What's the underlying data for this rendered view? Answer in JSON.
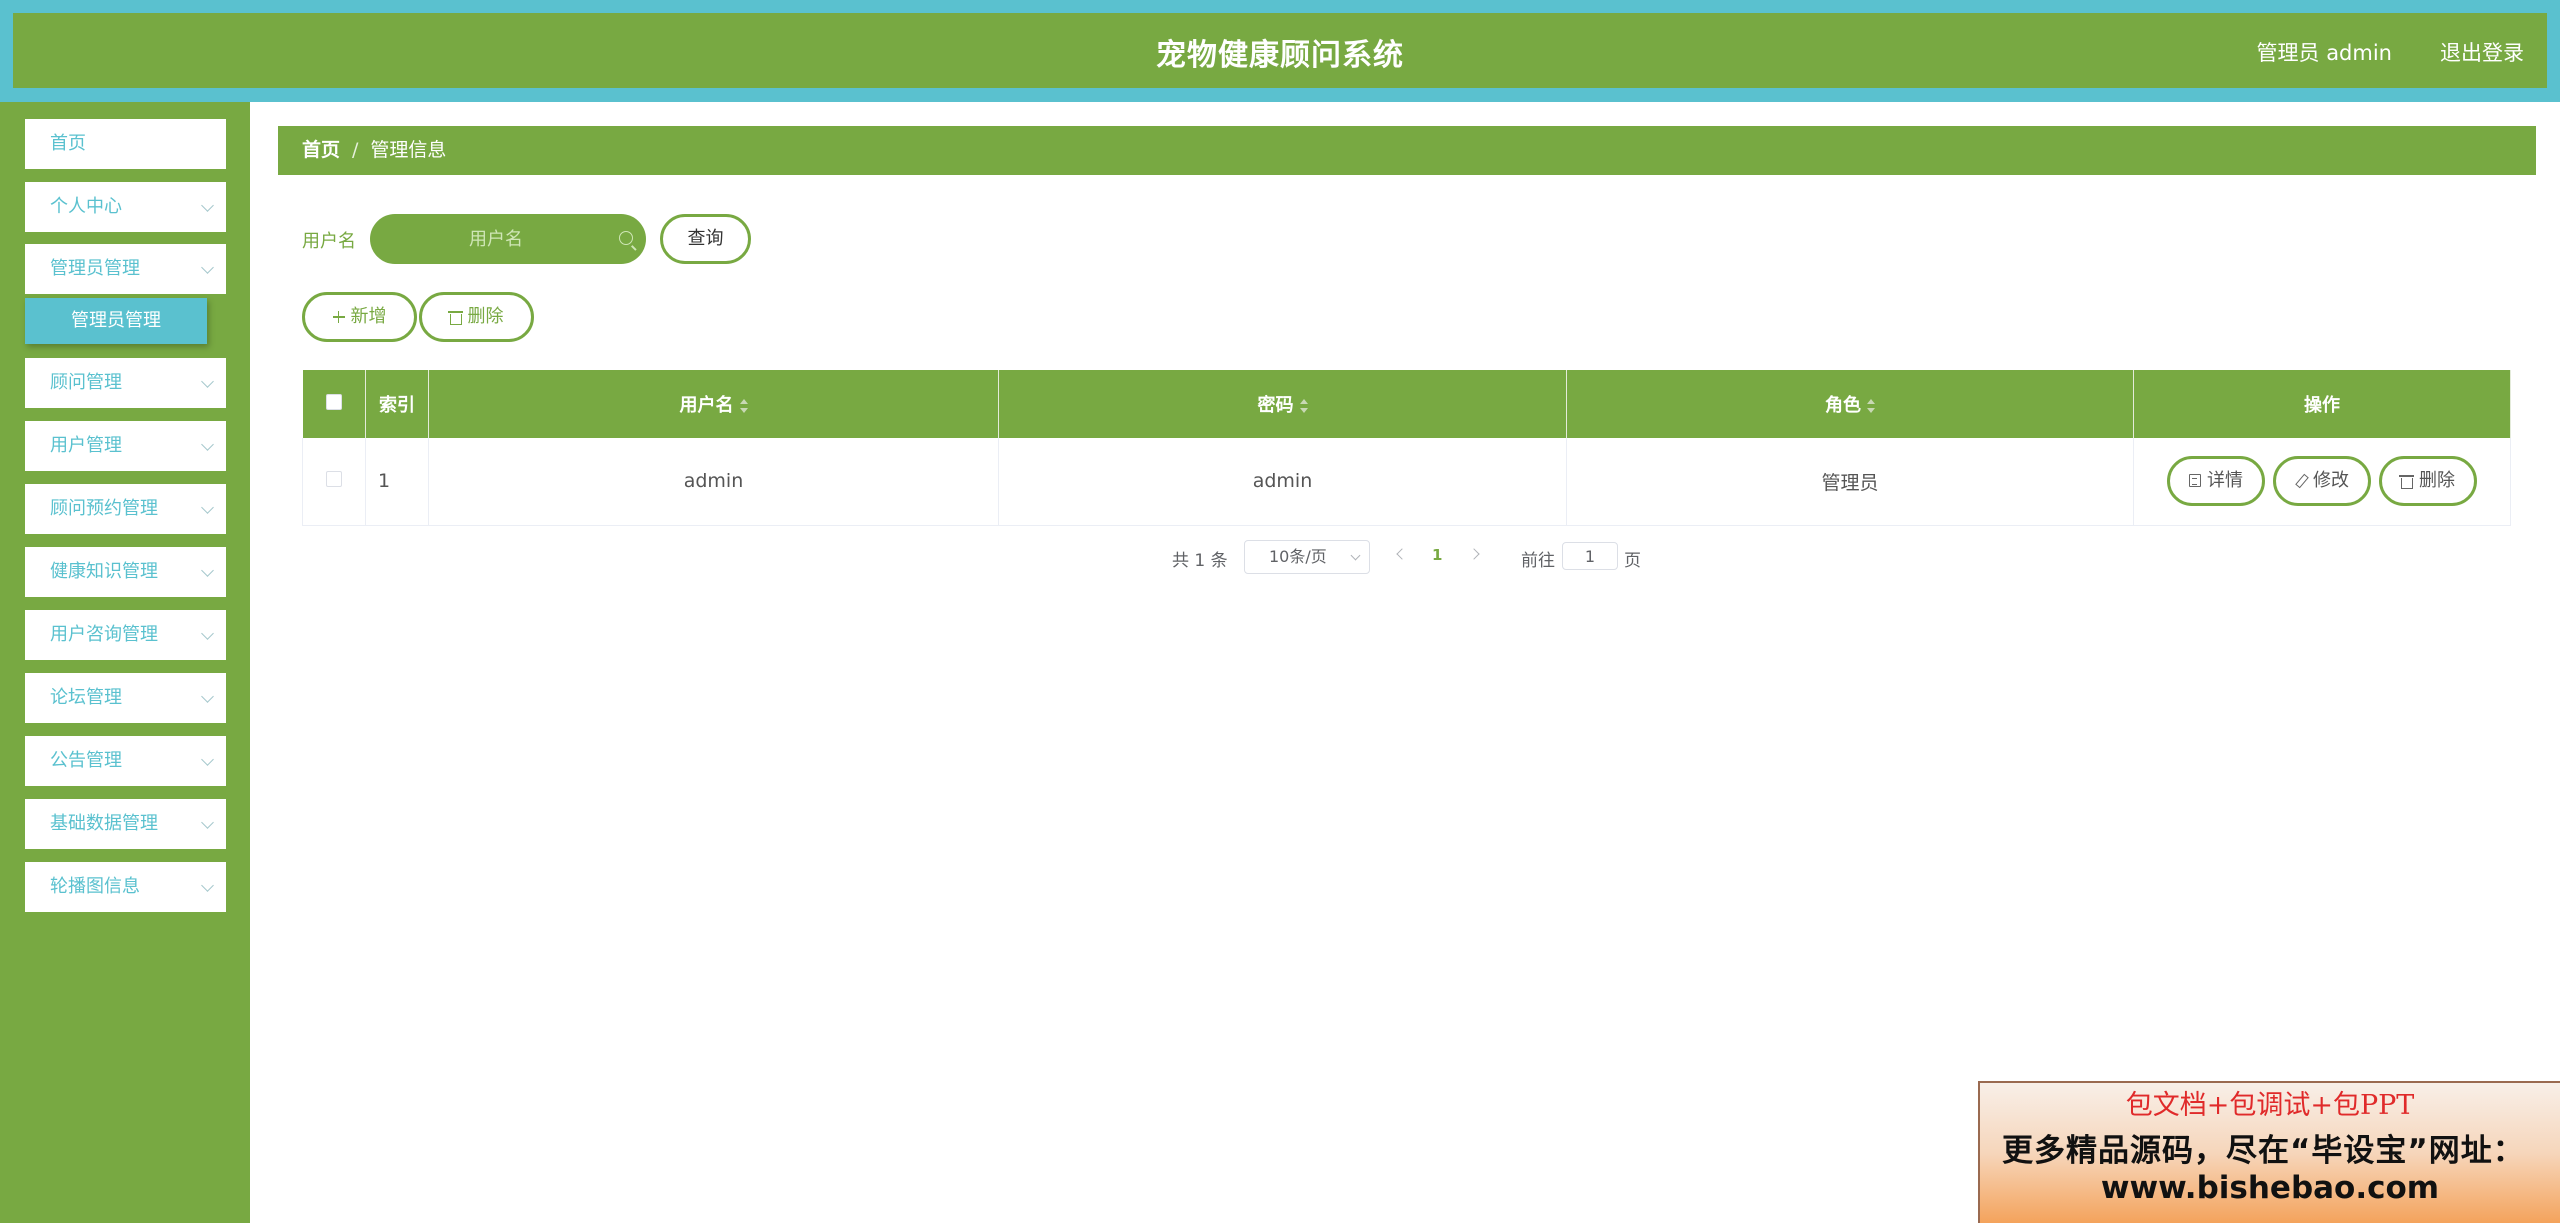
{
  "header": {
    "title": "宠物健康顾问系统",
    "user_info": "管理员 admin",
    "logout": "退出登录"
  },
  "sidebar": {
    "items": [
      {
        "label": "首页"
      },
      {
        "label": "个人中心"
      },
      {
        "label": "管理员管理"
      },
      {
        "label": "顾问管理"
      },
      {
        "label": "用户管理"
      },
      {
        "label": "顾问预约管理"
      },
      {
        "label": "健康知识管理"
      },
      {
        "label": "用户咨询管理"
      },
      {
        "label": "论坛管理"
      },
      {
        "label": "公告管理"
      },
      {
        "label": "基础数据管理"
      },
      {
        "label": "轮播图信息"
      }
    ],
    "active_submenu": "管理员管理"
  },
  "breadcrumb": {
    "home": "首页",
    "separator": "/",
    "current": "管理信息"
  },
  "search": {
    "label": "用户名",
    "placeholder": "用户名",
    "query_button": "查询"
  },
  "actions": {
    "add": "新增",
    "delete": "删除"
  },
  "table": {
    "columns": {
      "index": "索引",
      "username": "用户名",
      "password": "密码",
      "role": "角色",
      "operations": "操作"
    },
    "rows": [
      {
        "index": "1",
        "username": "admin",
        "password": "admin",
        "role": "管理员"
      }
    ],
    "row_actions": {
      "detail": "详情",
      "edit": "修改",
      "delete": "删除"
    }
  },
  "pagination": {
    "total": "共 1 条",
    "page_size": "10条/页",
    "current_page": "1",
    "goto_label": "前往",
    "goto_value": "1",
    "page_suffix": "页"
  },
  "ad": {
    "line1": "包文档+包调试+包PPT",
    "line2": "更多精品源码，尽在“毕设宝”网址：",
    "line3": "www.bishebao.com"
  },
  "colors": {
    "primary_green": "#78a942",
    "accent_teal": "#5ac1cf"
  }
}
